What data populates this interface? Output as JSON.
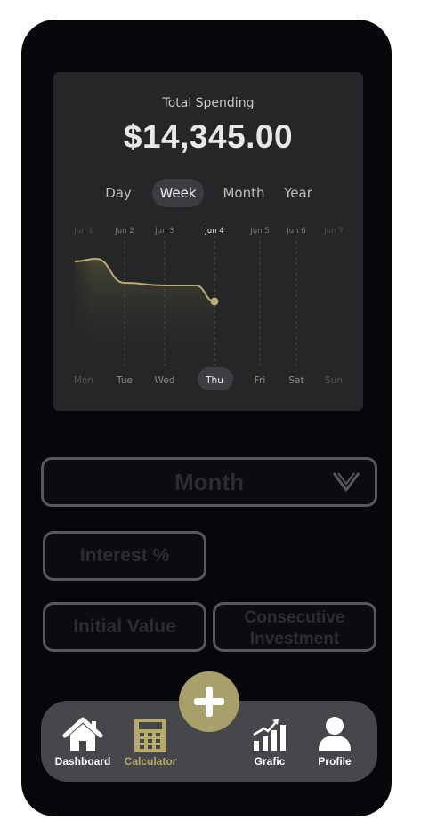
{
  "card": {
    "label": "Total Spending",
    "total": "$14,345.00"
  },
  "period_tabs": [
    {
      "label": "Day",
      "active": false
    },
    {
      "label": "Week",
      "active": true
    },
    {
      "label": "Month",
      "active": false
    },
    {
      "label": "Year",
      "active": false
    }
  ],
  "chart_data": {
    "type": "line",
    "dates": [
      "Jun 1",
      "Jun 2",
      "Jun 3",
      "Jun 4",
      "Jun 5",
      "Jun 6",
      "Jun 7"
    ],
    "weekdays": [
      "Mon",
      "Tue",
      "Wed",
      "Thu",
      "Fri",
      "Sat",
      "Sun"
    ],
    "selected_index": 3,
    "series": [
      {
        "values": [
          0.78,
          0.8,
          0.62,
          0.6,
          0.6,
          0.48
        ]
      }
    ],
    "value_scale": "relative (0-1), no y-axis printed",
    "line_color": "#b8ad72"
  },
  "form": {
    "period_select": "Month",
    "interest": "Interest %",
    "initial_value": "Initial Value",
    "consecutive_line1": "Consecutive",
    "consecutive_line2": "Investment"
  },
  "nav": {
    "dashboard": "Dashboard",
    "calculator": "Calculator",
    "grafic": "Grafic",
    "profile": "Profile",
    "active": "calculator"
  },
  "colors": {
    "accent": "#a8a06a",
    "background": "#06070a",
    "card": "#252628",
    "navbar": "#46474a"
  }
}
